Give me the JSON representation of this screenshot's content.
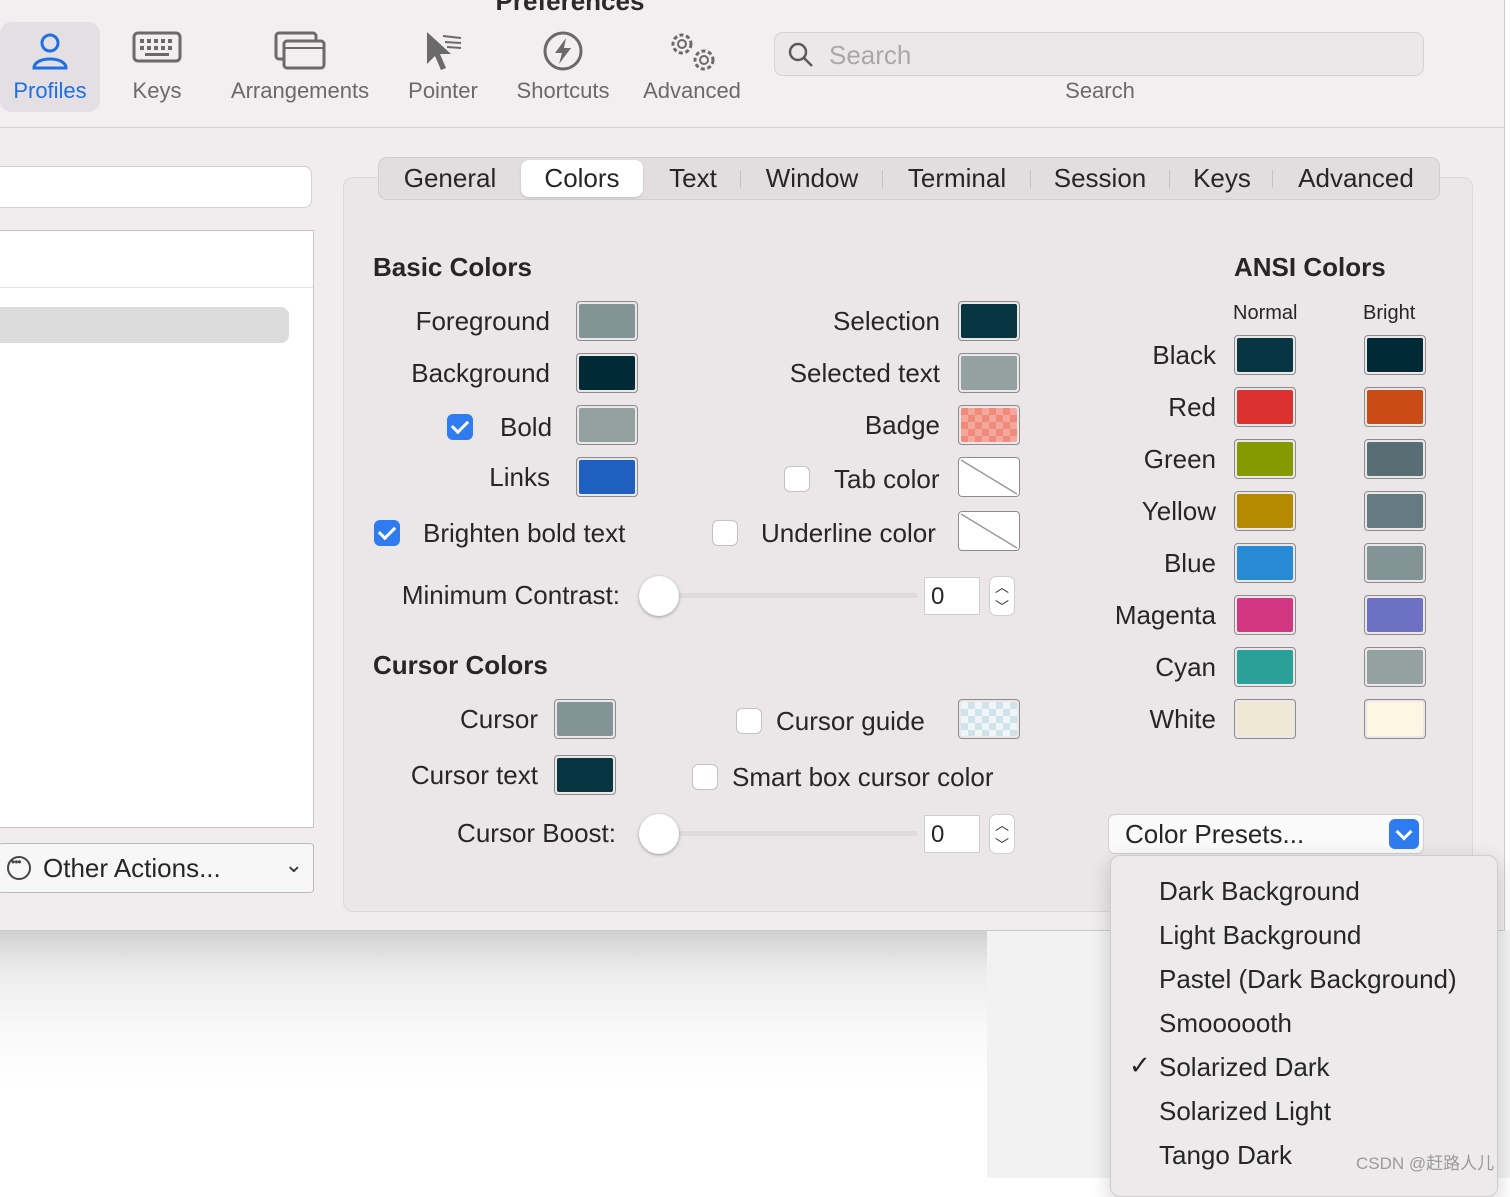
{
  "window": {
    "title": "Preferences"
  },
  "toolbar": {
    "items": [
      {
        "label": "Profiles",
        "icon": "person-icon",
        "active": true
      },
      {
        "label": "Keys",
        "icon": "keyboard-icon"
      },
      {
        "label": "Arrangements",
        "icon": "windows-icon"
      },
      {
        "label": "Pointer",
        "icon": "pointer-icon"
      },
      {
        "label": "Shortcuts",
        "icon": "lightning-icon"
      },
      {
        "label": "Advanced",
        "icon": "gears-icon"
      }
    ],
    "search": {
      "placeholder": "Search",
      "caption": "Search"
    }
  },
  "left_pane": {
    "other_actions_label": "Other Actions..."
  },
  "tabs": [
    "General",
    "Colors",
    "Text",
    "Window",
    "Terminal",
    "Session",
    "Keys",
    "Advanced"
  ],
  "selected_tab": "Colors",
  "basic_colors": {
    "heading": "Basic Colors",
    "foreground": {
      "label": "Foreground",
      "color": "#839496"
    },
    "background": {
      "label": "Background",
      "color": "#002b36"
    },
    "bold": {
      "label": "Bold",
      "checked": true,
      "color": "#93a1a1"
    },
    "links": {
      "label": "Links",
      "color": "#1f5fbf"
    },
    "brighten_bold": {
      "label": "Brighten bold text",
      "checked": true
    },
    "selection": {
      "label": "Selection",
      "color": "#073642"
    },
    "selected_text": {
      "label": "Selected text",
      "color": "#93a1a1"
    },
    "badge": {
      "label": "Badge",
      "color": "#f08a7a"
    },
    "tab_color": {
      "label": "Tab color",
      "checked": false
    },
    "underline_color": {
      "label": "Underline color",
      "checked": false
    },
    "min_contrast": {
      "label": "Minimum Contrast:",
      "value": "0"
    }
  },
  "cursor_colors": {
    "heading": "Cursor Colors",
    "cursor": {
      "label": "Cursor",
      "color": "#839496"
    },
    "cursor_text": {
      "label": "Cursor text",
      "color": "#073642"
    },
    "cursor_guide": {
      "label": "Cursor guide",
      "checked": false
    },
    "smart_box": {
      "label": "Smart box cursor color",
      "checked": false
    },
    "boost": {
      "label": "Cursor Boost:",
      "value": "0"
    }
  },
  "ansi_colors": {
    "heading": "ANSI Colors",
    "col_normal": "Normal",
    "col_bright": "Bright",
    "rows": [
      {
        "name": "Black",
        "normal": "#073642",
        "bright": "#002b36"
      },
      {
        "name": "Red",
        "normal": "#dc322f",
        "bright": "#cb4b16"
      },
      {
        "name": "Green",
        "normal": "#859900",
        "bright": "#586e75"
      },
      {
        "name": "Yellow",
        "normal": "#b58900",
        "bright": "#657b83"
      },
      {
        "name": "Blue",
        "normal": "#268bd2",
        "bright": "#839496"
      },
      {
        "name": "Magenta",
        "normal": "#d33682",
        "bright": "#6c71c4"
      },
      {
        "name": "Cyan",
        "normal": "#2aa198",
        "bright": "#93a1a1"
      },
      {
        "name": "White",
        "normal": "#eee8d5",
        "bright": "#fdf6e3"
      }
    ]
  },
  "color_presets": {
    "label": "Color Presets...",
    "items": [
      {
        "label": "Dark Background",
        "checked": false
      },
      {
        "label": "Light Background",
        "checked": false
      },
      {
        "label": "Pastel (Dark Background)",
        "checked": false
      },
      {
        "label": "Smoooooth",
        "checked": false
      },
      {
        "label": "Solarized Dark",
        "checked": true
      },
      {
        "label": "Solarized Light",
        "checked": false
      },
      {
        "label": "Tango Dark",
        "checked": false
      }
    ]
  },
  "watermark": "CSDN @赶路人儿",
  "checkmark": "✓"
}
